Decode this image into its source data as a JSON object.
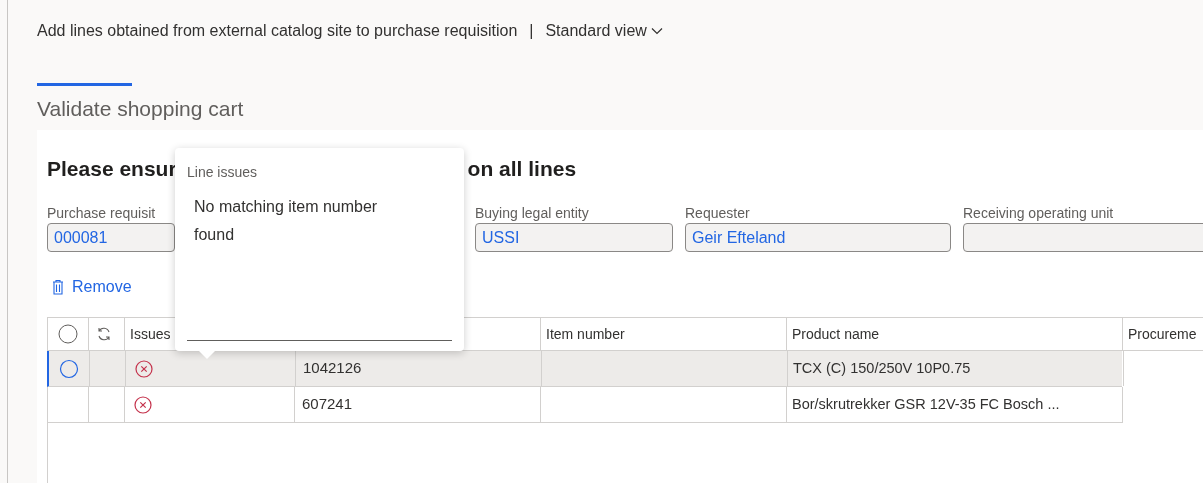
{
  "header": {
    "title": "Add lines obtained from external catalog site to purchase requisition",
    "separator": "|",
    "view": "Standard view"
  },
  "tab": {
    "label": "Validate shopping cart",
    "selected": true
  },
  "heading_parts": [
    "Please ensur",
    "on all lines"
  ],
  "fields": [
    {
      "label": "Purchase requisit",
      "value": "000081"
    },
    {
      "label": "Buying legal entity",
      "value": "USSI"
    },
    {
      "label": "Requester",
      "value": "Geir Efteland"
    },
    {
      "label": "Receiving operating unit"
    }
  ],
  "remove_button": {
    "label": "Remove"
  },
  "popup": {
    "title": "Line issues",
    "message": "No matching item number found"
  },
  "table": {
    "columns": [
      "",
      "",
      "Issues",
      "",
      "Item number",
      "Product name",
      "Procureme"
    ],
    "rows": [
      {
        "selected": true,
        "has_issue": true,
        "column_4": "1042126",
        "item_number": "",
        "product_name": "TCX (C) 150/250V 10P0.75"
      },
      {
        "selected": false,
        "has_issue": true,
        "column_4": "607241",
        "item_number": "",
        "product_name": "Bor/skrutrekker GSR 12V-35 FC Bosch ..."
      }
    ]
  }
}
